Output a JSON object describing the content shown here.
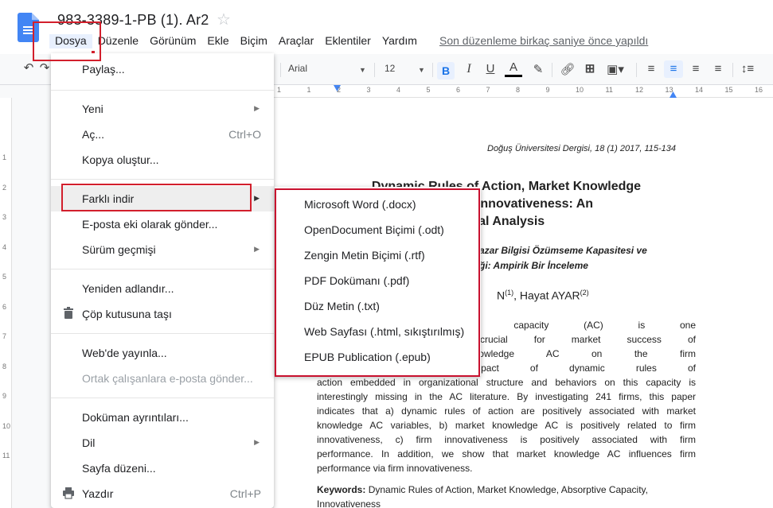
{
  "document": {
    "title": "983-3389-1-PB (1). Ar2",
    "last_edit": "Son düzenleme birkaç saniye önce yapıldı"
  },
  "menubar": [
    "Dosya",
    "Düzenle",
    "Görünüm",
    "Ekle",
    "Biçim",
    "Araçlar",
    "Eklentiler",
    "Yardım"
  ],
  "toolbar": {
    "font": "Arial",
    "size": "12"
  },
  "ruler": {
    "h_ticks": [
      "1",
      "1",
      "2",
      "3",
      "4",
      "5",
      "6",
      "7",
      "8",
      "9",
      "10",
      "11",
      "12",
      "13",
      "14",
      "15",
      "16",
      "17"
    ],
    "v_ticks": [
      "1",
      "2",
      "3",
      "4",
      "5",
      "6",
      "7",
      "8",
      "9",
      "10",
      "11"
    ]
  },
  "file_menu": {
    "share": "Paylaş...",
    "new": "Yeni",
    "open": "Aç...",
    "open_shortcut": "Ctrl+O",
    "copy": "Kopya oluştur...",
    "download_as": "Farklı indir",
    "email_attachment": "E-posta eki olarak gönder...",
    "version_history": "Sürüm geçmişi",
    "rename": "Yeniden adlandır...",
    "trash": "Çöp kutusuna taşı",
    "publish": "Web'de yayınla...",
    "email_collaborators": "Ortak çalışanlara e-posta gönder...",
    "details": "Doküman ayrıntıları...",
    "language": "Dil",
    "page_setup": "Sayfa düzeni...",
    "print": "Yazdır",
    "print_shortcut": "Ctrl+P"
  },
  "download_submenu": [
    "Microsoft Word (.docx)",
    "OpenDocument Biçimi (.odt)",
    "Zengin Metin Biçimi (.rtf)",
    "PDF Dokümanı (.pdf)",
    "Düz Metin (.txt)",
    "Web Sayfası (.html, sıkıştırılmış)",
    "EPUB Publication (.epub)"
  ],
  "page": {
    "meta": "Doğuş Üniversitesi Dergisi, 18 (1) 2017, 115-134",
    "title_1": "Dynamic Rules of Action, Market Knowledge",
    "title_2": "and Firm Innovativeness: An",
    "title_3": "ical Analysis",
    "subtitle_1": "azar Bilgisi Özümseme Kapasitesi ve",
    "subtitle_2": "ği: Ampirik Bir İnceleme",
    "author_1": "N",
    "author_1_sup": "(1)",
    "author_2": ", Hayat AYAR",
    "author_2_sup": "(2)",
    "abstract": [
      "t knowledge absorptive capacity (AC) is one",
      "rm has which is crucial for market success of",
      "ffect of market knowledge AC on the firm",
      "rocess) and the impact of dynamic rules of",
      "action embedded in organizational structure and behaviors on this capacity is",
      "interestingly missing in the AC literature. By investigating 241 firms, this paper",
      "indicates that a) dynamic rules of action are positively associated with market",
      "knowledge AC variables, b) market knowledge AC is positively related to firm",
      "innovativeness, c) firm innovativeness is positively associated with firm",
      "performance. In addition, we show that market knowledge AC influences firm",
      "performance via firm innovativeness."
    ],
    "keywords_label": "Keywords:",
    "keywords": " Dynamic Rules of Action, Market Knowledge, Absorptive Capacity,",
    "keywords_2": "Innovativeness"
  },
  "colors": {
    "accent": "#1a73e8",
    "highlight_box": "#d21f2c",
    "docs_blue": "#4285f4"
  }
}
